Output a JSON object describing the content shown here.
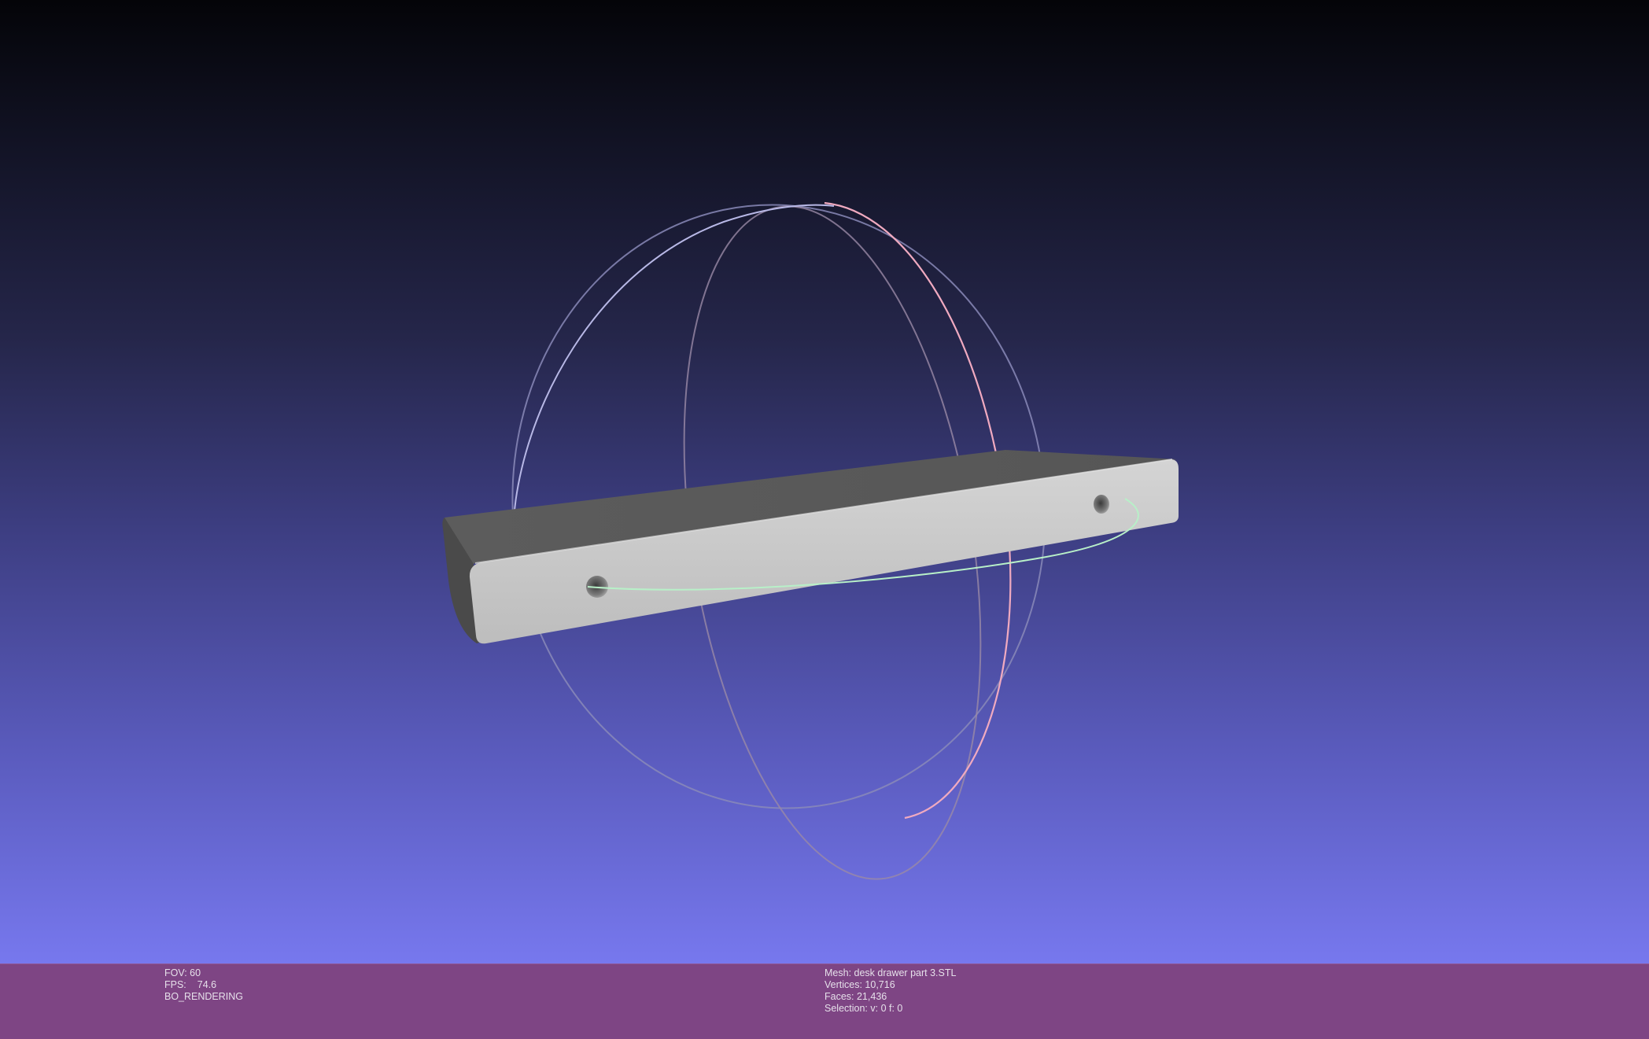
{
  "app": "MeshLab 3D viewport",
  "render_info": {
    "fov_label": "FOV: 60",
    "fps_label": "FPS:",
    "fps_value": "74.6",
    "render_mode": "BO_RENDERING"
  },
  "mesh_info": {
    "mesh": "Mesh: desk drawer part 3.STL",
    "vertices": "Vertices: 10,716",
    "faces": "Faces: 21,436",
    "selection": "Selection: v: 0 f: 0"
  },
  "colors": {
    "background_top": "#040408",
    "background_bottom": "#7778ee",
    "status_bar": "#7e4584",
    "mesh_front": "#c9c9c9",
    "mesh_top": "#5a5a5a",
    "trackball_red": "#e8a4b8",
    "trackball_green": "#a8e8c0",
    "trackball_blue": "#a8a8d8"
  },
  "icons": {
    "trackball": "trackball-gizmo-icon"
  }
}
